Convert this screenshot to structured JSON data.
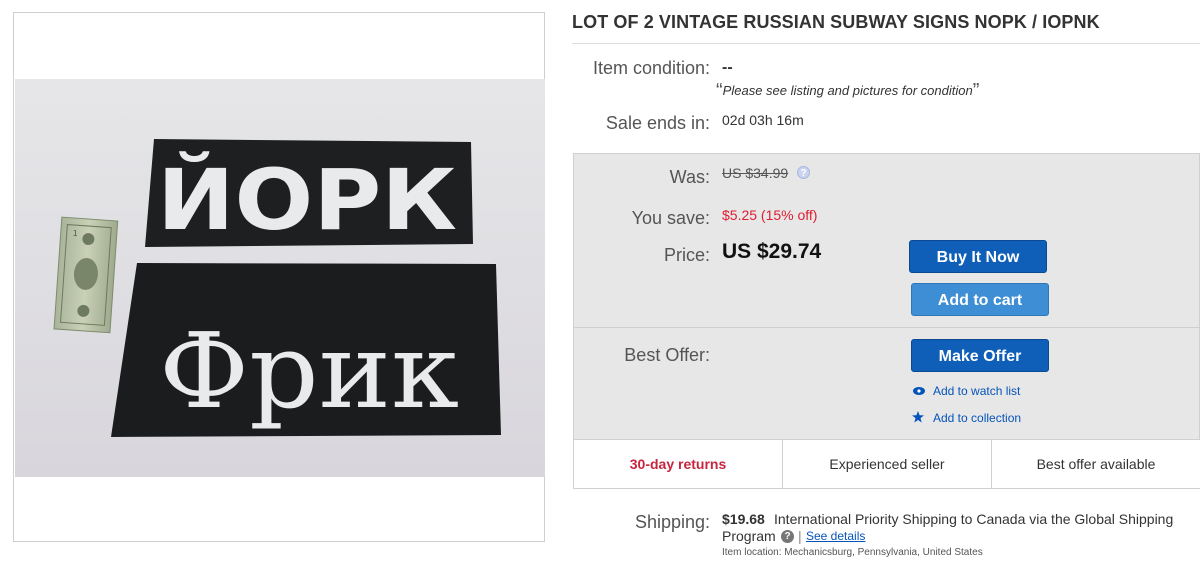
{
  "listing": {
    "title": "LOT OF 2 VINTAGE RUSSIAN SUBWAY SIGNS NOPK / IOPNK",
    "photo": {
      "sign_top_text": "ЙОРК",
      "sign_bottom_text": "Фрик",
      "banknote_label": "1"
    }
  },
  "condition": {
    "label": "Item condition:",
    "value": "--",
    "open_quote": "“",
    "note": "Please see listing and pictures for condition",
    "close_quote": "”"
  },
  "sale": {
    "label": "Sale ends in:",
    "value": "02d 03h 16m"
  },
  "pricing": {
    "was_label": "Was:",
    "was_value": "US $34.99",
    "help_icon": "?",
    "save_label": "You save:",
    "save_value": "$5.25 (15% off)",
    "price_label": "Price:",
    "price_value": "US $29.74",
    "best_offer_label": "Best Offer:"
  },
  "actions": {
    "buy_now": "Buy It Now",
    "add_to_cart": "Add to cart",
    "make_offer": "Make Offer",
    "watch_list": "Add to watch list",
    "collection": "Add to collection"
  },
  "badges": [
    "30-day returns",
    "Experienced seller",
    "Best offer available"
  ],
  "shipping": {
    "label": "Shipping:",
    "cost": "$19.68",
    "text": "International Priority Shipping to Canada  via the Global Shipping",
    "text_line2": "Program",
    "help_icon": "?",
    "separator": "|",
    "see_details": "See details",
    "location": "Item location:  Mechanicsburg, Pennsylvania, United States"
  },
  "colors": {
    "buy_button": "#0f5fb8",
    "cart_button": "#3d8ed4",
    "save_text": "#dd1e31",
    "returns_text": "#c7263e",
    "link": "#0654ba"
  }
}
